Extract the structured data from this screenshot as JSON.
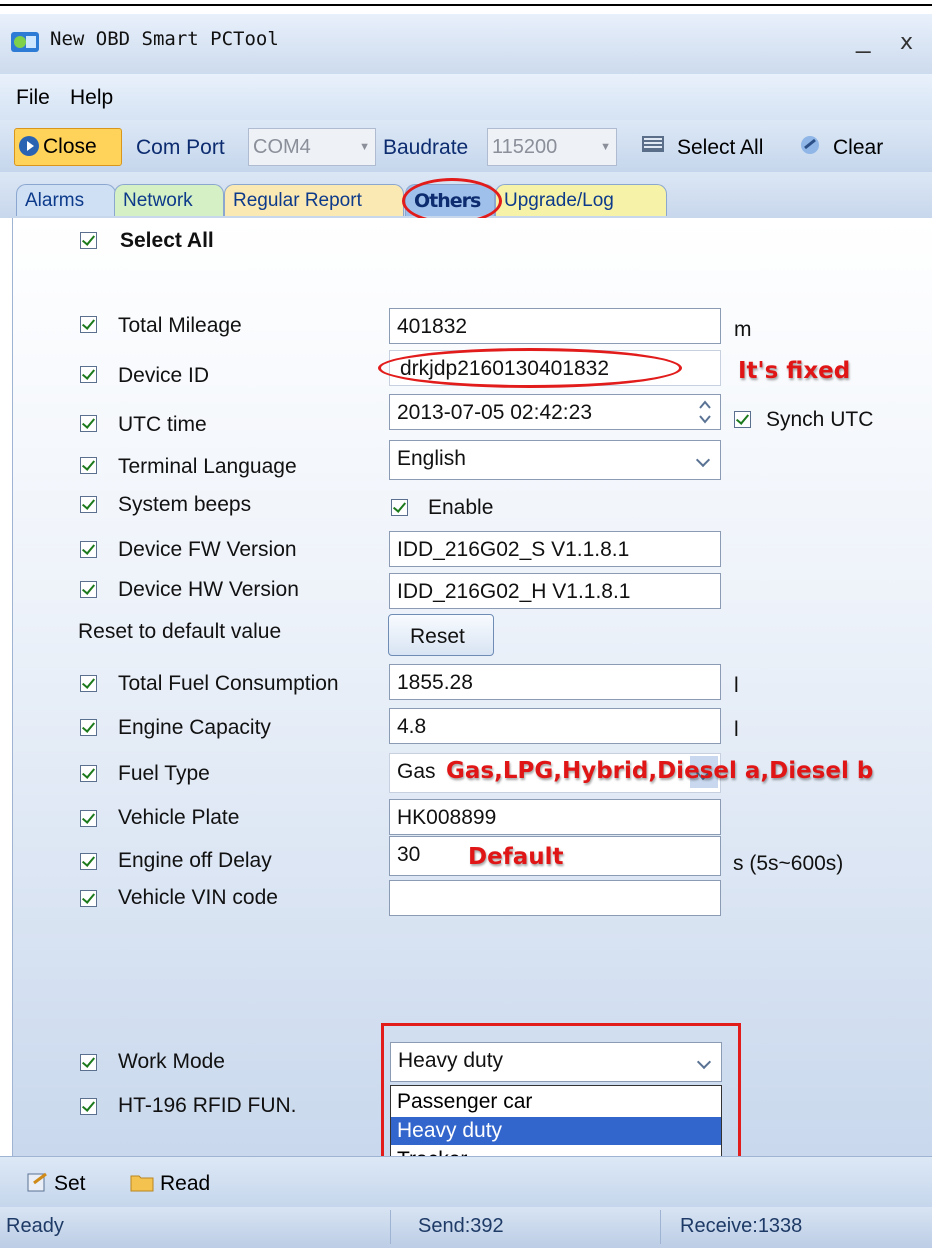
{
  "window": {
    "title": "New OBD Smart PCTool",
    "minimize": "_",
    "close": "x"
  },
  "menu": {
    "file": "File",
    "help": "Help"
  },
  "toolbar": {
    "close_label": "Close",
    "com_port_label": "Com Port",
    "com_port_value": "COM4",
    "baudrate_label": "Baudrate",
    "baudrate_value": "115200",
    "select_all_label": "Select All",
    "clear_label": "Clear"
  },
  "tabs": [
    {
      "label": "Alarms"
    },
    {
      "label": "Network"
    },
    {
      "label": "Regular Report"
    },
    {
      "label": "Others",
      "active": true
    },
    {
      "label": "Upgrade/Log"
    }
  ],
  "others": {
    "select_all": "Select All",
    "total_mileage": {
      "label": "Total Mileage",
      "value": "401832",
      "unit": "m"
    },
    "device_id": {
      "label": "Device ID",
      "value": "drkjdp2160130401832",
      "note": "It's fixed"
    },
    "utc_time": {
      "label": "UTC time",
      "value": "2013-07-05 02:42:23",
      "synch_label": "Synch UTC"
    },
    "terminal_language": {
      "label": "Terminal Language",
      "value": "English"
    },
    "system_beeps": {
      "label": "System beeps",
      "enable_label": "Enable"
    },
    "fw_version": {
      "label": "Device FW Version",
      "value": "IDD_216G02_S V1.1.8.1"
    },
    "hw_version": {
      "label": "Device HW Version",
      "value": "IDD_216G02_H V1.1.8.1"
    },
    "reset": {
      "label": "Reset to default value",
      "button": "Reset"
    },
    "total_fuel": {
      "label": "Total Fuel Consumption",
      "value": "1855.28",
      "unit": "l"
    },
    "engine_capacity": {
      "label": "Engine Capacity",
      "value": "4.8",
      "unit": "l"
    },
    "fuel_type": {
      "label": "Fuel Type",
      "value": "Gas",
      "note": "Gas,LPG,Hybrid,Diesel a,Diesel b"
    },
    "vehicle_plate": {
      "label": "Vehicle Plate",
      "value": "HK008899"
    },
    "engine_off_delay": {
      "label": "Engine off Delay",
      "value": "30",
      "note": "Default",
      "unit": "s (5s~600s)"
    },
    "vin": {
      "label": "Vehicle VIN code",
      "value": ""
    },
    "work_mode": {
      "label": "Work Mode",
      "value": "Heavy duty",
      "options": [
        "Passenger car",
        "Heavy duty",
        "Tracker"
      ],
      "selected": "Heavy duty"
    },
    "rfid": {
      "label": "HT-196 RFID FUN."
    }
  },
  "bottom": {
    "set_label": "Set",
    "read_label": "Read"
  },
  "status": {
    "ready": "Ready",
    "send": "Send:392",
    "receive": "Receive:1338"
  }
}
